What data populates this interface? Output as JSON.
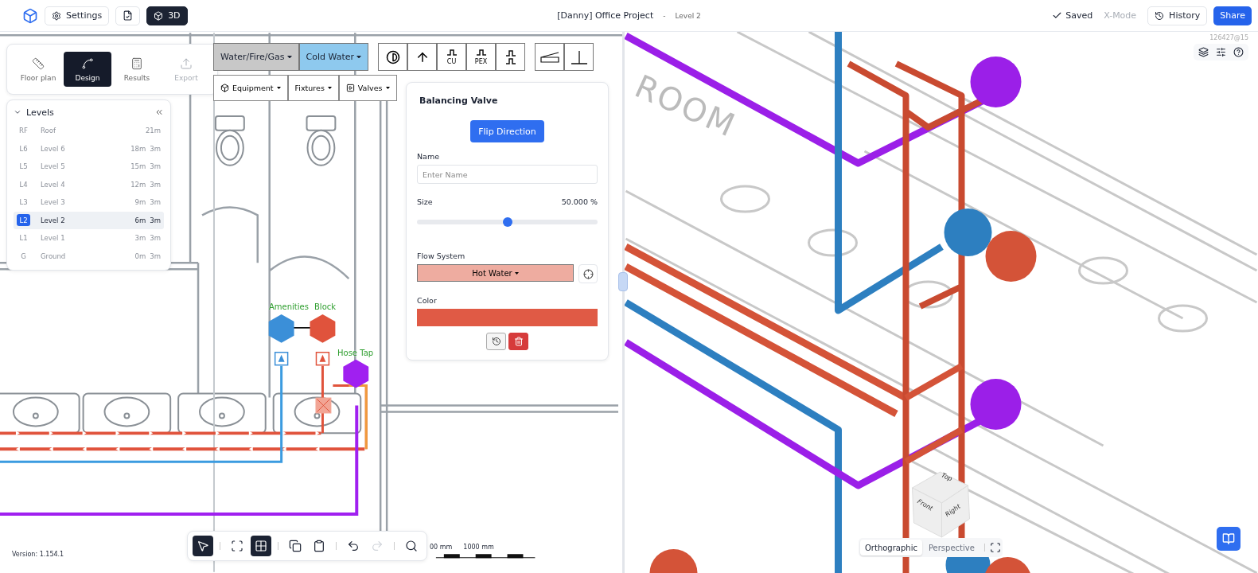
{
  "header": {
    "settings": "Settings",
    "view_3d": {
      "label": "3D",
      "selected": true
    },
    "title": "[Danny] Office Project",
    "separator": "-",
    "level": "Level 2",
    "saved": "Saved",
    "x_mode": {
      "label": "X-Mode",
      "disabled": true
    },
    "history": "History",
    "share": "Share"
  },
  "mode_tabs": [
    {
      "kind": "ruler",
      "label": "Floor plan",
      "selected": false,
      "disabled": false
    },
    {
      "kind": "design",
      "label": "Design",
      "selected": true,
      "disabled": false
    },
    {
      "kind": "calculator",
      "label": "Results",
      "selected": false,
      "disabled": false
    },
    {
      "kind": "upload",
      "label": "Export",
      "selected": false,
      "disabled": true
    }
  ],
  "levels": {
    "title": "Levels",
    "items": [
      {
        "code": "RF",
        "name": "Roof",
        "elevation": "21m",
        "selected": false
      },
      {
        "code": "L6",
        "name": "Level 6",
        "elevation": "18m",
        "height": "3m",
        "selected": false
      },
      {
        "code": "L5",
        "name": "Level 5",
        "elevation": "15m",
        "height": "3m",
        "selected": false
      },
      {
        "code": "L4",
        "name": "Level 4",
        "elevation": "12m",
        "height": "3m",
        "selected": false
      },
      {
        "code": "L3",
        "name": "Level 3",
        "elevation": "9m",
        "height": "3m",
        "selected": false
      },
      {
        "code": "L2",
        "name": "Level 2",
        "elevation": "6m",
        "height": "3m",
        "selected": true
      },
      {
        "code": "L1",
        "name": "Level 1",
        "elevation": "3m",
        "height": "3m",
        "selected": false
      },
      {
        "code": "G",
        "name": "Ground",
        "elevation": "0m",
        "height": "3m",
        "selected": false
      }
    ]
  },
  "systems": [
    {
      "label": "Water/Fire/Gas",
      "selected": false
    },
    {
      "label": "Cold Water",
      "selected": true
    }
  ],
  "pipe_tools": [
    {
      "kind": "contrast"
    },
    {
      "kind": "arrow"
    },
    {
      "kind": "material",
      "label": "CU"
    },
    {
      "kind": "material",
      "label": "PEX"
    },
    {
      "kind": "wave"
    },
    {
      "kind": "slope"
    },
    {
      "kind": "tee"
    }
  ],
  "menus": [
    {
      "kind": "equipment",
      "label": "Equipment"
    },
    {
      "kind": "fixtures",
      "label": "Fixtures"
    },
    {
      "kind": "valves",
      "label": "Valves"
    }
  ],
  "properties": {
    "title": "Balancing Valve",
    "flip_button": "Flip Direction",
    "name_label": "Name",
    "name_placeholder": "Enter Name",
    "size_label": "Size",
    "size_reading": "50.000 %",
    "size_slider": {
      "level": 0.5
    },
    "flow_label": "Flow System",
    "flow_value": "Hot Water",
    "color_label": "Color",
    "color": "#e05a45"
  },
  "plan_labels": [
    {
      "text": "Amenities"
    },
    {
      "text": "Block"
    },
    {
      "text": "Hose Tap"
    }
  ],
  "scale": [
    "00 mm",
    "1000 mm"
  ],
  "version": "Version: 1.154.1",
  "bottom_tools": [
    {
      "kind": "select",
      "selected": true,
      "disabled": false
    },
    {
      "kind": "frame",
      "selected": false,
      "disabled": false
    },
    {
      "kind": "grid",
      "selected": true,
      "disabled": false
    },
    {
      "kind": "copy",
      "selected": false,
      "disabled": false
    },
    {
      "kind": "paste",
      "selected": false,
      "disabled": false
    },
    {
      "kind": "undo",
      "selected": false,
      "disabled": false
    },
    {
      "kind": "redo",
      "selected": false,
      "disabled": true
    },
    {
      "kind": "search",
      "selected": false,
      "disabled": false
    }
  ],
  "view3d": {
    "id": "126427@15",
    "room_label": "ROOM",
    "cube": [
      "Top",
      "Front",
      "Right"
    ],
    "projections": [
      {
        "label": "Orthographic",
        "selected": true
      },
      {
        "label": "Perspective",
        "selected": false
      }
    ]
  }
}
